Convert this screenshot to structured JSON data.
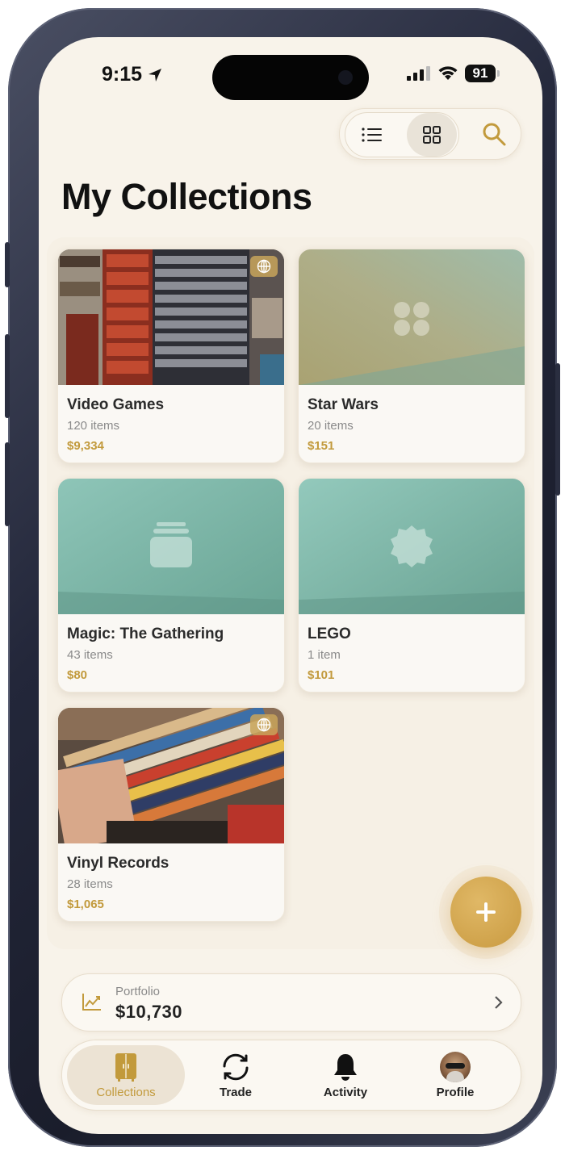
{
  "status_bar": {
    "time": "9:15",
    "battery": "91"
  },
  "toolbar": {
    "list_icon": "list-icon",
    "grid_icon": "grid-icon",
    "search_icon": "search-icon",
    "active_view": "grid"
  },
  "page_title": "My Collections",
  "collections": [
    {
      "name": "Video Games",
      "count": "120 items",
      "value": "$9,334",
      "image": "video-games-shelves-photo",
      "public": true
    },
    {
      "name": "Star Wars",
      "count": "20 items",
      "value": "$151",
      "image": "placeholder-olive",
      "public": false
    },
    {
      "name": "Magic: The Gathering",
      "count": "43 items",
      "value": "$80",
      "image": "placeholder-teal-cards",
      "public": false
    },
    {
      "name": "LEGO",
      "count": "1 item",
      "value": "$101",
      "image": "placeholder-teal-badge",
      "public": false
    },
    {
      "name": "Vinyl Records",
      "count": "28 items",
      "value": "$1,065",
      "image": "vinyl-records-crate-photo",
      "public": true
    }
  ],
  "fab": {
    "icon": "plus-icon"
  },
  "portfolio": {
    "label": "Portfolio",
    "value": "$10,730"
  },
  "tabbar": {
    "tabs": [
      {
        "label": "Collections",
        "icon": "cabinet-icon",
        "active": true
      },
      {
        "label": "Trade",
        "icon": "trade-icon",
        "active": false
      },
      {
        "label": "Activity",
        "icon": "bell-icon",
        "active": false
      },
      {
        "label": "Profile",
        "icon": "avatar",
        "active": false
      }
    ]
  },
  "colors": {
    "accent": "#c29a3c",
    "background": "#f8f3ea",
    "teal": "#7bb3a6",
    "olive": "#b0ad86"
  }
}
